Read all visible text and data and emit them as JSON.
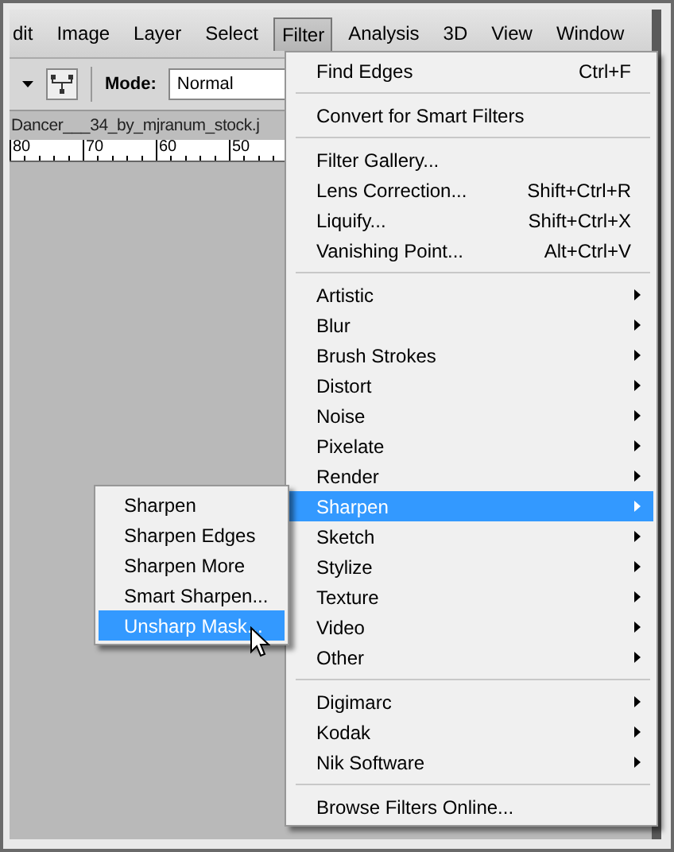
{
  "menubar": [
    {
      "label": "dit",
      "selected": false
    },
    {
      "label": "Image",
      "selected": false
    },
    {
      "label": "Layer",
      "selected": false
    },
    {
      "label": "Select",
      "selected": false
    },
    {
      "label": "Filter",
      "selected": true
    },
    {
      "label": "Analysis",
      "selected": false
    },
    {
      "label": "3D",
      "selected": false
    },
    {
      "label": "View",
      "selected": false
    },
    {
      "label": "Window",
      "selected": false
    }
  ],
  "toolbar": {
    "mode_label": "Mode:",
    "mode_value": "Normal"
  },
  "document_tab": "Dancer___34_by_mjranum_stock.j",
  "ruler": [
    "80",
    "70",
    "60",
    "50"
  ],
  "filter_menu": [
    [
      {
        "label": "Find Edges",
        "shortcut": "Ctrl+F",
        "submenu": false,
        "selected": false
      }
    ],
    [
      {
        "label": "Convert for Smart Filters",
        "submenu": false,
        "selected": false
      }
    ],
    [
      {
        "label": "Filter Gallery...",
        "submenu": false,
        "selected": false
      },
      {
        "label": "Lens Correction...",
        "shortcut": "Shift+Ctrl+R",
        "submenu": false,
        "selected": false
      },
      {
        "label": "Liquify...",
        "shortcut": "Shift+Ctrl+X",
        "submenu": false,
        "selected": false
      },
      {
        "label": "Vanishing Point...",
        "shortcut": "Alt+Ctrl+V",
        "submenu": false,
        "selected": false
      }
    ],
    [
      {
        "label": "Artistic",
        "submenu": true,
        "selected": false
      },
      {
        "label": "Blur",
        "submenu": true,
        "selected": false
      },
      {
        "label": "Brush Strokes",
        "submenu": true,
        "selected": false
      },
      {
        "label": "Distort",
        "submenu": true,
        "selected": false
      },
      {
        "label": "Noise",
        "submenu": true,
        "selected": false
      },
      {
        "label": "Pixelate",
        "submenu": true,
        "selected": false
      },
      {
        "label": "Render",
        "submenu": true,
        "selected": false
      },
      {
        "label": "Sharpen",
        "submenu": true,
        "selected": true
      },
      {
        "label": "Sketch",
        "submenu": true,
        "selected": false
      },
      {
        "label": "Stylize",
        "submenu": true,
        "selected": false
      },
      {
        "label": "Texture",
        "submenu": true,
        "selected": false
      },
      {
        "label": "Video",
        "submenu": true,
        "selected": false
      },
      {
        "label": "Other",
        "submenu": true,
        "selected": false
      }
    ],
    [
      {
        "label": "Digimarc",
        "submenu": true,
        "selected": false
      },
      {
        "label": "Kodak",
        "submenu": true,
        "selected": false
      },
      {
        "label": "Nik Software",
        "submenu": true,
        "selected": false
      }
    ],
    [
      {
        "label": "Browse Filters Online...",
        "submenu": false,
        "selected": false
      }
    ]
  ],
  "sharpen_submenu": [
    {
      "label": "Sharpen",
      "selected": false
    },
    {
      "label": "Sharpen Edges",
      "selected": false
    },
    {
      "label": "Sharpen More",
      "selected": false
    },
    {
      "label": "Smart Sharpen...",
      "selected": false
    },
    {
      "label": "Unsharp Mask...",
      "selected": true
    }
  ]
}
